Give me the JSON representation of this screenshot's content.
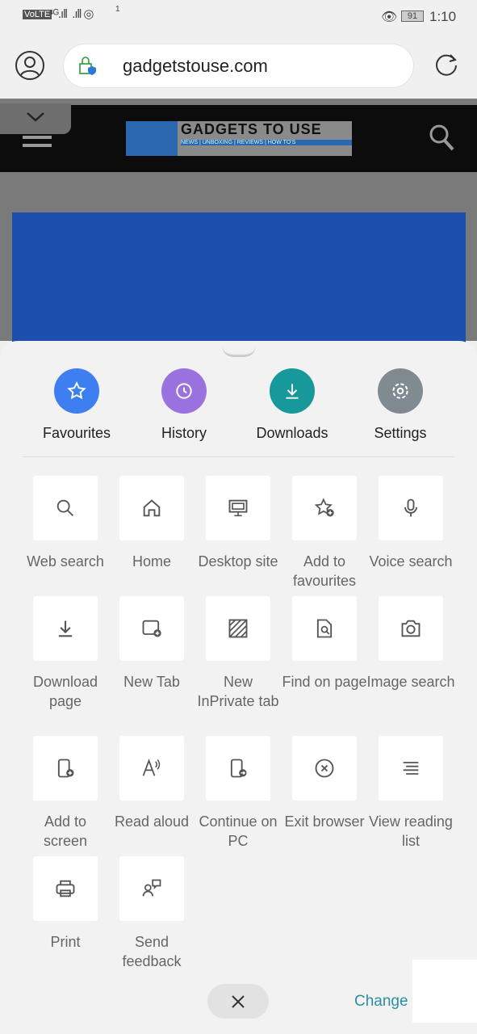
{
  "status": {
    "time": "1:10",
    "battery": "91",
    "sim_sup": "1"
  },
  "browser": {
    "url": "gadgetstouse.com"
  },
  "site": {
    "logo_text": "GADGETS TO USE",
    "logo_tagline": "NEWS | UNBOXING | REVIEWS | HOW TO'S"
  },
  "quick": [
    {
      "label": "Favourites",
      "icon": "star-icon",
      "color": "#3d7ff0"
    },
    {
      "label": "History",
      "icon": "history-icon",
      "color": "#9a72e0"
    },
    {
      "label": "Downloads",
      "icon": "download-icon",
      "color": "#17999b"
    },
    {
      "label": "Settings",
      "icon": "gear-icon",
      "color": "#7f8b90"
    }
  ],
  "tiles": [
    {
      "label": "Web search",
      "icon": "search-icon"
    },
    {
      "label": "Home",
      "icon": "home-icon"
    },
    {
      "label": "Desktop site",
      "icon": "desktop-icon"
    },
    {
      "label": "Add to favourites",
      "icon": "star-add-icon"
    },
    {
      "label": "Voice search",
      "icon": "microphone-icon"
    },
    {
      "label": "Download page",
      "icon": "download-icon"
    },
    {
      "label": "New Tab",
      "icon": "new-tab-icon"
    },
    {
      "label": "New InPrivate tab",
      "icon": "inprivate-icon"
    },
    {
      "label": "Find on page",
      "icon": "find-icon"
    },
    {
      "label": "Image search",
      "icon": "camera-icon"
    },
    {
      "label": "Add to screen",
      "icon": "add-to-screen-icon"
    },
    {
      "label": "Read aloud",
      "icon": "read-aloud-icon"
    },
    {
      "label": "Continue on PC",
      "icon": "continue-pc-icon"
    },
    {
      "label": "Exit browser",
      "icon": "exit-icon"
    },
    {
      "label": "View reading list",
      "icon": "reading-list-icon"
    },
    {
      "label": "Print",
      "icon": "print-icon"
    },
    {
      "label": "Send feedback",
      "icon": "feedback-icon"
    }
  ],
  "footer": {
    "change_label": "Change m"
  }
}
